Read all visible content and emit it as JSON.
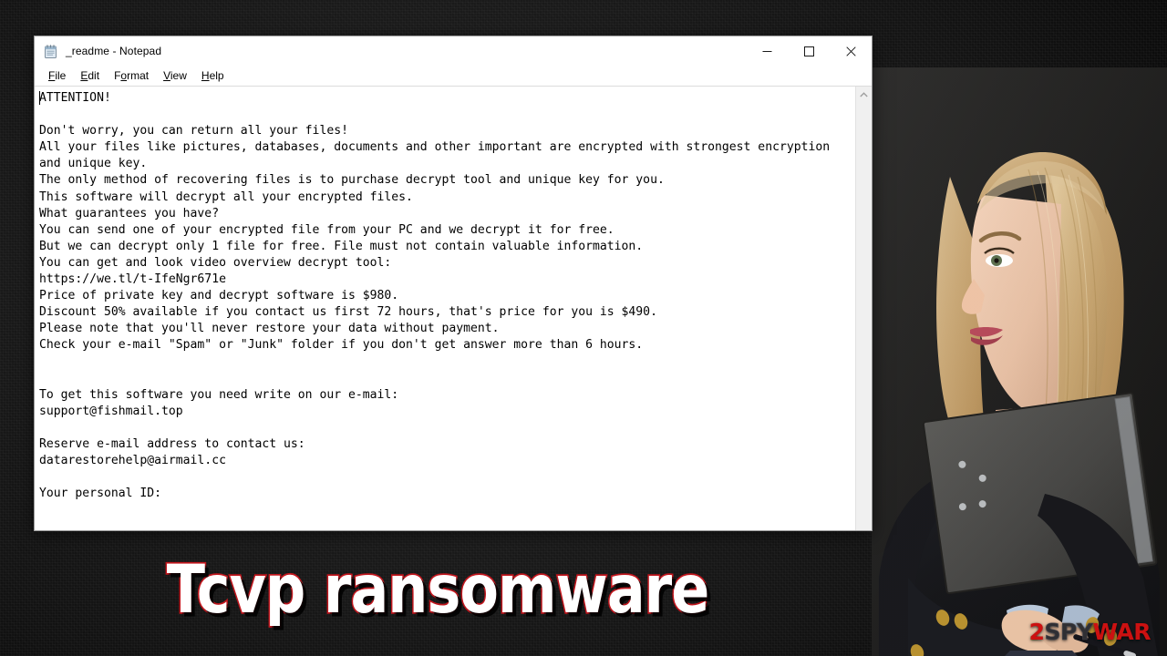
{
  "window": {
    "title": "_readme - Notepad",
    "icon": "notepad-icon",
    "controls": {
      "minimize": "—",
      "maximize": "□",
      "close": "✕"
    },
    "menu": [
      {
        "label": "File",
        "accel": "F"
      },
      {
        "label": "Edit",
        "accel": "E"
      },
      {
        "label": "Format",
        "accel": "o"
      },
      {
        "label": "View",
        "accel": "V"
      },
      {
        "label": "Help",
        "accel": "H"
      }
    ],
    "scrollbar": {
      "up_arrow": "▲",
      "down_arrow": "▼"
    }
  },
  "note": {
    "body": "ATTENTION!\n\nDon't worry, you can return all your files!\nAll your files like pictures, databases, documents and other important are encrypted with strongest encryption\nand unique key.\nThe only method of recovering files is to purchase decrypt tool and unique key for you.\nThis software will decrypt all your encrypted files.\nWhat guarantees you have?\nYou can send one of your encrypted file from your PC and we decrypt it for free.\nBut we can decrypt only 1 file for free. File must not contain valuable information.\nYou can get and look video overview decrypt tool:\nhttps://we.tl/t-IfeNgr671e\nPrice of private key and decrypt software is $980.\nDiscount 50% available if you contact us first 72 hours, that's price for you is $490.\nPlease note that you'll never restore your data without payment.\nCheck your e-mail \"Spam\" or \"Junk\" folder if you don't get answer more than 6 hours.\n\n\nTo get this software you need write on our e-mail:\nsupport@fishmail.top\n\nReserve e-mail address to contact us:\ndatarestorehelp@airmail.cc\n\nYour personal ID:",
    "lines": [
      "ATTENTION!",
      "",
      "Don't worry, you can return all your files!",
      "All your files like pictures, databases, documents and other important are encrypted with strongest encryption",
      "and unique key.",
      "The only method of recovering files is to purchase decrypt tool and unique key for you.",
      "This software will decrypt all your encrypted files.",
      "What guarantees you have?",
      "You can send one of your encrypted file from your PC and we decrypt it for free.",
      "But we can decrypt only 1 file for free. File must not contain valuable information.",
      "You can get and look video overview decrypt tool:",
      "https://we.tl/t-IfeNgr671e",
      "Price of private key and decrypt software is $980.",
      "Discount 50% available if you contact us first 72 hours, that's price for you is $490.",
      "Please note that you'll never restore your data without payment.",
      "Check your e-mail \"Spam\" or \"Junk\" folder if you don't get answer more than 6 hours.",
      "",
      "",
      "To get this software you need write on our e-mail:",
      "support@fishmail.top",
      "",
      "Reserve e-mail address to contact us:",
      "datarestorehelp@airmail.cc",
      "",
      "Your personal ID:"
    ],
    "details": {
      "video_url": "https://we.tl/t-IfeNgr671e",
      "price_full": "$980",
      "price_discount": "$490",
      "discount_percent": "50%",
      "discount_window": "72 hours",
      "response_time": "6 hours",
      "free_files": "1 file",
      "primary_email": "support@fishmail.top",
      "reserve_email": "datarestorehelp@airmail.cc"
    }
  },
  "banner": {
    "title": "Tcvp ransomware",
    "fill_color": "#ffffff",
    "outline_color": "#c1161d"
  },
  "watermark": {
    "part1": "2",
    "part2": "SPY",
    "part3": "WAR",
    "red": "#cc1111",
    "gray": "#2f2f33"
  },
  "photo": {
    "alt": "woman-in-dark-blazer-holding-binder"
  }
}
